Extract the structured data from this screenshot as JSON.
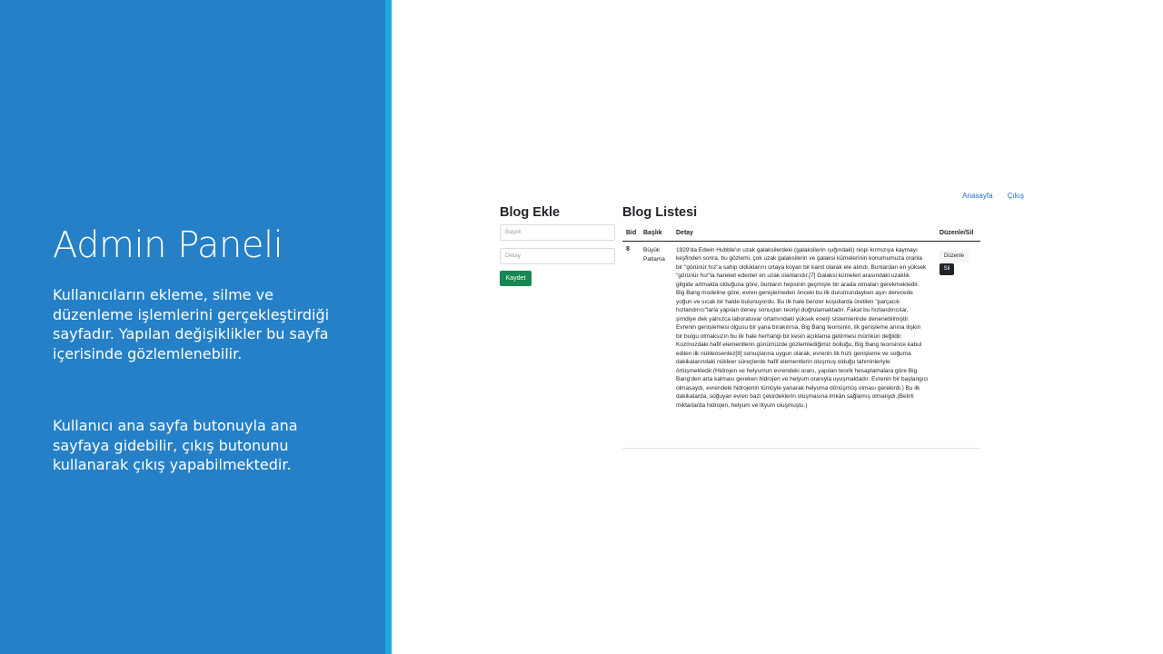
{
  "slide": {
    "title": "Admin Paneli",
    "paragraph1": "Kullanıcıların ekleme, silme ve düzenleme işlemlerini gerçekleştirdiği sayfadır. Yapılan değişiklikler bu sayfa içerisinde gözlemlenebilir.",
    "paragraph2": "Kullanıcı ana sayfa butonuyla ana sayfaya gidebilir, çıkış butonunu kullanarak çıkış yapabilmektedir.",
    "colors": {
      "panel": "#2580c7",
      "stripe": "#1fa5e3"
    }
  },
  "nav": {
    "home_label": "Anasayfa",
    "logout_label": "Çıkış"
  },
  "blog_add": {
    "heading": "Blog Ekle",
    "title_placeholder": "Başlık",
    "detail_placeholder": "Detay",
    "save_label": "Kaydet"
  },
  "blog_list": {
    "heading": "Blog Listesi",
    "columns": [
      "Bid",
      "Başlık",
      "Detay",
      "Düzenle/Sil"
    ],
    "rows": [
      {
        "bid": "8",
        "title": "Büyük Patlama",
        "detail": "1929'da Edwin Hubble'ın uzak galaksilerdeki (galaksilerin ışığındaki) nispi kırmızıya kaymayı keşfinden sonra, bu gözlemi, çok uzak galaksilerin ve galaksi kümelerinin konumumuza oranla bir \"görünür hız\"a sahip olduklarını ortaya koyan bir kanıt olarak ele alındı. Bunlardan en yüksek \"görünür hız\"la hareket edenler en uzak olanlarıdır.[7] Galaksi kümeleri arasındaki uzaklık gitgide artmakta olduğuna göre, bunların hepsinin geçmişte bir arada olmaları gerekmektedir. Big Bang modeline göre, evren genişlemeden önceki bu ilk durumundayken aşırı derecede yoğun ve sıcak bir halde bulunuyordu. Bu ilk hale benzer koşullarda üretilen \"parçacık hızlandırıcı\"larla yapılan deney sonuçları teoriyi doğrulamaktadır. Fakat bu hızlandırıcılar, şimdiye dek yalnızca laboratuvar ortamındaki yüksek enerji sistemlerinde denenebilmiştir. Evrenin genişlemesi olgusu bir yana bırakılırsa, Big Bang teorisinin, ilk genişleme anına ilişkin bir bulgu olmaksızın bu ilk hale herhangi bir kesin açıklama getirmesi mümkün değildir. Kozmozdaki hafif elementlerin günümüzde gözlemlediğimiz bolluğu, Big Bang teorisince kabul edilen ilk nükleosentez[8] sonuçlarına uygun olarak, evrenin ilk hızlı genişleme ve soğuma dakikalarındaki nükleer süreçlerde hafif elementlerin oluşmuş olduğu tahminleriyle örtüşmektedir.(Hidrojen ve helyumun evrendeki oranı, yapılan teorik hesaplamalara göre Big Bang'den arta kalması gereken hidrojen ve helyum oranıyla uyuşmaktadır. Evrenin bir başlangıcı olmasaydı, evrendeki hidrojenin tümüyle yanarak helyuma dönüşmüş olması gerekirdi.) Bu ilk dakikalarda, soğuyan evren bazı çekirdeklerin oluşmasına imkân sağlamış olmalıydı.(Belirli miktarlarda hidrojen, helyum ve lityum oluşmuştu.)",
        "edit_label": "Düzenle",
        "delete_label": "Sil"
      }
    ]
  }
}
